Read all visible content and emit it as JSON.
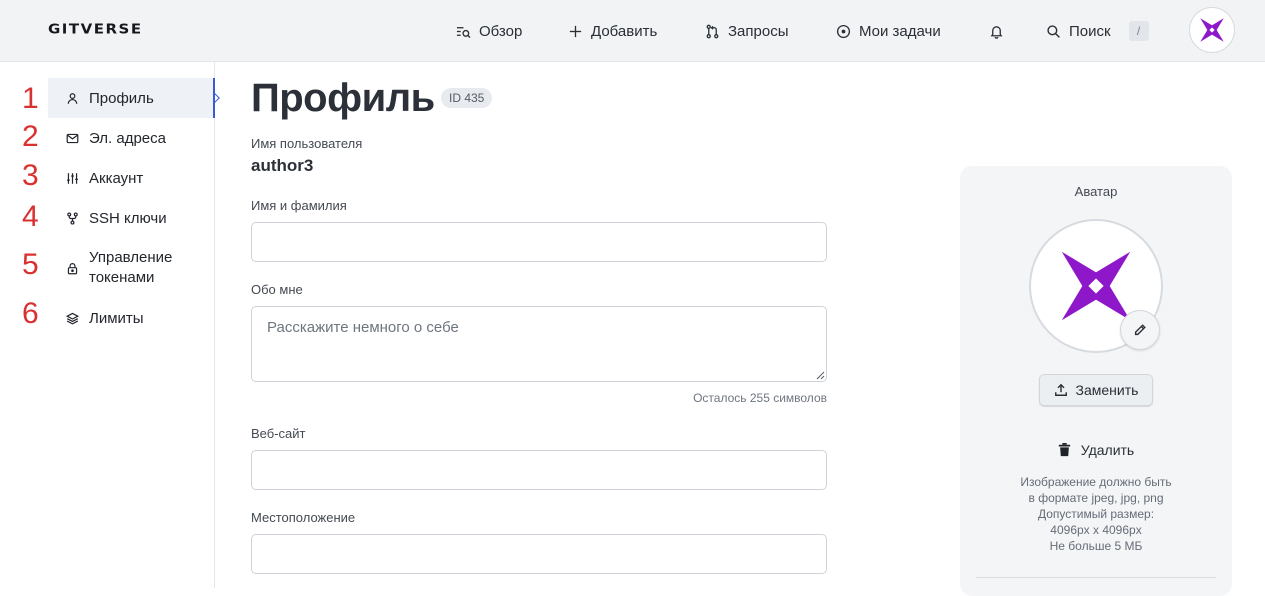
{
  "header": {
    "logo": "GITVERSE",
    "nav": [
      {
        "label": "Обзор",
        "icon": "search-list-icon"
      },
      {
        "label": "Добавить",
        "icon": "plus-icon"
      },
      {
        "label": "Запросы",
        "icon": "pull-request-icon"
      },
      {
        "label": "Мои задачи",
        "icon": "issue-icon"
      }
    ],
    "search_label": "Поиск",
    "search_shortcut": "/"
  },
  "sidebar": {
    "items": [
      {
        "label": "Профиль",
        "number": "1",
        "icon": "user-icon",
        "active": true
      },
      {
        "label": "Эл. адреса",
        "number": "2",
        "icon": "mail-icon"
      },
      {
        "label": "Аккаунт",
        "number": "3",
        "icon": "sliders-icon"
      },
      {
        "label": "SSH ключи",
        "number": "4",
        "icon": "fork-icon"
      },
      {
        "label": "Управление токенами",
        "number": "5",
        "icon": "lock-icon"
      },
      {
        "label": "Лимиты",
        "number": "6",
        "icon": "layers-icon"
      }
    ]
  },
  "main": {
    "title": "Профиль",
    "id_badge": "ID 435",
    "username_label": "Имя пользователя",
    "username": "author3",
    "fullname_label": "Имя и фамилия",
    "fullname_value": "",
    "about_label": "Обо мне",
    "about_placeholder": "Расскажите немного о себе",
    "about_counter": "Осталось 255 символов",
    "website_label": "Веб-сайт",
    "website_value": "",
    "location_label": "Местоположение",
    "location_value": ""
  },
  "avatar_card": {
    "title": "Аватар",
    "replace_label": "Заменить",
    "delete_label": "Удалить",
    "hint_lines": [
      "Изображение должно быть",
      "в формате jpeg, jpg, png",
      "Допустимый размер:",
      "4096px x 4096px",
      "Не больше 5 МБ"
    ]
  },
  "colors": {
    "accent": "#3b5bd6",
    "logo_purple": "#8e17c9",
    "annotation_red": "#d8312f",
    "header_bg": "#f1f3f5"
  }
}
